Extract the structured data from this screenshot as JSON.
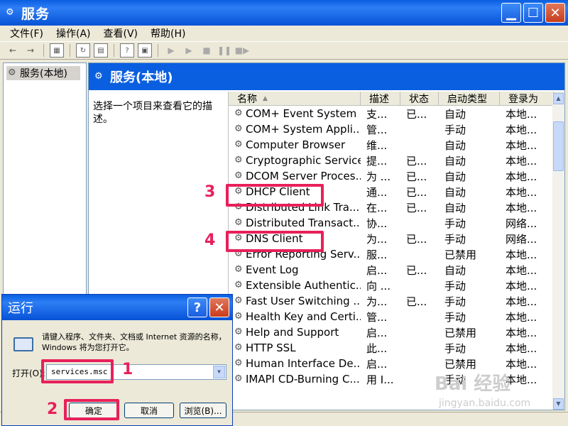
{
  "window": {
    "title": "服务"
  },
  "menu": [
    "文件(F)",
    "操作(A)",
    "查看(V)",
    "帮助(H)"
  ],
  "tree": {
    "item": "服务(本地)"
  },
  "main": {
    "header": "服务(本地)",
    "description": "选择一个项目来查看它的描述。"
  },
  "columns": [
    "名称",
    "描述",
    "状态",
    "启动类型",
    "登录为"
  ],
  "services": [
    {
      "name": "COM+ Event System",
      "desc": "支...",
      "status": "已...",
      "startup": "自动",
      "logon": "本地..."
    },
    {
      "name": "COM+ System Appli...",
      "desc": "管...",
      "status": "",
      "startup": "手动",
      "logon": "本地..."
    },
    {
      "name": "Computer Browser",
      "desc": "维...",
      "status": "",
      "startup": "自动",
      "logon": "本地..."
    },
    {
      "name": "Cryptographic Services",
      "desc": "提...",
      "status": "已...",
      "startup": "自动",
      "logon": "本地..."
    },
    {
      "name": "DCOM Server Proces...",
      "desc": "为 ...",
      "status": "已...",
      "startup": "自动",
      "logon": "本地..."
    },
    {
      "name": "DHCP Client",
      "desc": "通...",
      "status": "已...",
      "startup": "自动",
      "logon": "本地..."
    },
    {
      "name": "Distributed Link Tra...",
      "desc": "在...",
      "status": "已...",
      "startup": "自动",
      "logon": "本地..."
    },
    {
      "name": "Distributed Transact...",
      "desc": "协...",
      "status": "",
      "startup": "手动",
      "logon": "网络..."
    },
    {
      "name": "DNS Client",
      "desc": "为...",
      "status": "已...",
      "startup": "手动",
      "logon": "网络..."
    },
    {
      "name": "Error Reporting Serv...",
      "desc": "服...",
      "status": "",
      "startup": "已禁用",
      "logon": "本地..."
    },
    {
      "name": "Event Log",
      "desc": "启...",
      "status": "已...",
      "startup": "自动",
      "logon": "本地..."
    },
    {
      "name": "Extensible Authentic...",
      "desc": "向 ...",
      "status": "",
      "startup": "手动",
      "logon": "本地..."
    },
    {
      "name": "Fast User Switching ...",
      "desc": "为...",
      "status": "已...",
      "startup": "手动",
      "logon": "本地..."
    },
    {
      "name": "Health Key and Certi...",
      "desc": "管...",
      "status": "",
      "startup": "手动",
      "logon": "本地..."
    },
    {
      "name": "Help and Support",
      "desc": "启...",
      "status": "",
      "startup": "已禁用",
      "logon": "本地..."
    },
    {
      "name": "HTTP SSL",
      "desc": "此...",
      "status": "",
      "startup": "手动",
      "logon": "本地..."
    },
    {
      "name": "Human Interface De...",
      "desc": "启...",
      "status": "",
      "startup": "已禁用",
      "logon": "本地..."
    },
    {
      "name": "IMAPI CD-Burning C...",
      "desc": "用 I...",
      "status": "",
      "startup": "手动",
      "logon": "本地..."
    }
  ],
  "run_dialog": {
    "title": "运行",
    "prompt": "请键入程序、文件夹、文档或 Internet 资源的名称，Windows 将为您打开它。",
    "open_label": "打开(O):",
    "input_value": "services.msc",
    "ok": "确定",
    "cancel": "取消",
    "browse": "浏览(B)..."
  },
  "annotations": [
    "1",
    "2",
    "3",
    "4"
  ],
  "watermark": {
    "line1": "Bai 经验",
    "line2": "jingyan.baidu.com"
  },
  "colors": {
    "titlebar": "#0a5fe0",
    "highlight": "#e8205a",
    "background": "#ece9d8"
  }
}
